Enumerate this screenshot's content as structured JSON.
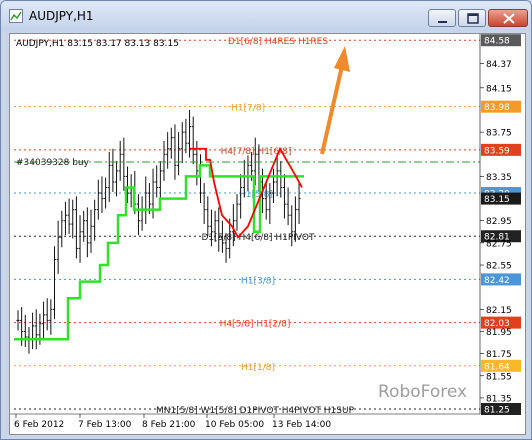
{
  "window": {
    "title": "AUDJPY,H1",
    "accent": "#4f6ea8"
  },
  "chart": {
    "header": "AUDJPY,H1  83.15 83.17 83.13 83.15",
    "watermark": "RoboForex",
    "arrow_color": "#f08a2a",
    "buy_order": "#34039328 buy"
  },
  "chart_data": {
    "type": "candlestick",
    "symbol": "AUDJPY",
    "timeframe": "H1",
    "ohlc_header": {
      "open": 83.15,
      "high": 83.17,
      "low": 83.13,
      "close": 83.15
    },
    "price_axis": [
      "84.58",
      "84.37",
      "84.15",
      "83.98",
      "83.75",
      "83.59",
      "83.35",
      "83.20",
      "83.15",
      "82.95",
      "82.81",
      "82.75",
      "82.55",
      "82.42",
      "82.15",
      "82.03",
      "81.95",
      "81.75",
      "81.64",
      "81.55",
      "81.35",
      "81.25"
    ],
    "highlighted_prices": [
      {
        "value": "84.58",
        "color": "#5a5a5a"
      },
      {
        "value": "83.98",
        "color": "#f39b2a"
      },
      {
        "value": "83.59",
        "color": "#e2401c"
      },
      {
        "value": "83.20",
        "color": "#4a96d8"
      },
      {
        "value": "83.15",
        "color": "#1a1a1a"
      },
      {
        "value": "82.81",
        "color": "#222222"
      },
      {
        "value": "82.42",
        "color": "#4a96d8"
      },
      {
        "value": "82.03",
        "color": "#e2401c"
      },
      {
        "value": "81.64",
        "color": "#f7b928"
      },
      {
        "value": "81.25",
        "color": "#222222"
      }
    ],
    "time_axis": [
      "6 Feb 2012",
      "7 Feb 13:00",
      "8 Feb 21:00",
      "10 Feb 05:00",
      "13 Feb 14:00"
    ],
    "levels": [
      {
        "label": "D1[6/8] H4RES H1RES",
        "price": 84.58,
        "color": "#e2401c"
      },
      {
        "label": "H1[7/8]",
        "price": 83.98,
        "color": "#f39b2a"
      },
      {
        "label": "H4[7/8] H1[6/8]",
        "price": 83.59,
        "color": "#e2401c"
      },
      {
        "label": "H1[5/8]",
        "price": 83.2,
        "color": "#4a96d8"
      },
      {
        "label": "D1[5/8] H4[6/8] H1PIVOT",
        "price": 82.81,
        "color": "#222222"
      },
      {
        "label": "H1[3/8]",
        "price": 82.42,
        "color": "#4a96d8"
      },
      {
        "label": "H4[5/8] H1[2/8]",
        "price": 82.03,
        "color": "#e2401c"
      },
      {
        "label": "H1[1/8]",
        "price": 81.64,
        "color": "#f39b2a"
      },
      {
        "label": "MN1[5/8] W1[5/8] D1PIVOT H4PIVOT H1SUP",
        "price": 81.25,
        "color": "#222222"
      }
    ],
    "buy_order_level": 83.33,
    "closes": [
      82.05,
      81.95,
      81.9,
      81.88,
      82.0,
      81.92,
      82.02,
      82.1,
      82.05,
      82.15,
      82.6,
      82.8,
      82.95,
      83.0,
      82.92,
      83.05,
      82.7,
      82.85,
      82.95,
      82.75,
      82.9,
      83.05,
      83.2,
      83.15,
      83.25,
      83.45,
      83.3,
      83.4,
      83.55,
      83.35,
      83.2,
      83.25,
      83.1,
      82.95,
      83.05,
      83.2,
      83.1,
      83.3,
      83.25,
      83.4,
      83.55,
      83.6,
      83.7,
      83.45,
      83.6,
      83.75,
      83.65,
      83.8,
      83.55,
      83.4,
      83.2,
      83.05,
      82.9,
      82.85,
      82.95,
      82.8,
      82.75,
      82.7,
      82.85,
      82.95,
      83.1,
      83.25,
      83.35,
      83.45,
      83.4,
      83.55,
      83.3,
      83.15,
      83.05,
      83.2,
      83.3,
      83.4,
      83.25,
      83.1,
      83.0,
      82.85,
      83.05,
      83.15
    ],
    "series": [
      {
        "name": "red_stop_line",
        "color": "#ff0000"
      },
      {
        "name": "green_stop_line",
        "color": "#33e02a"
      }
    ]
  }
}
